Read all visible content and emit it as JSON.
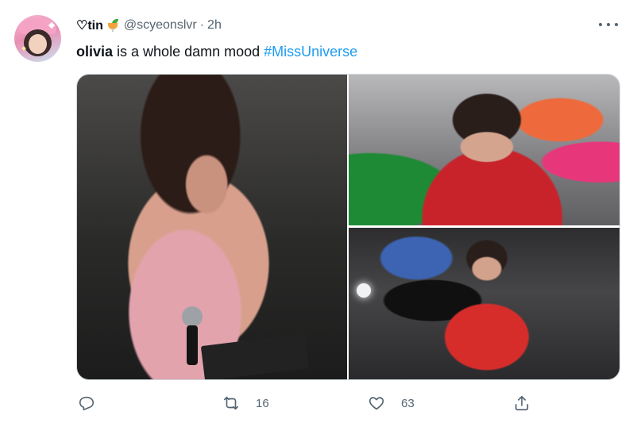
{
  "tweet": {
    "author": {
      "display_name": "♡tin",
      "handle": "@scyeonslvr",
      "separator": "·",
      "time": "2h"
    },
    "text": {
      "bold_word": "olivia",
      "rest": " is a whole damn mood ",
      "hashtag": "#MissUniverse"
    },
    "media": {
      "photos": [
        {
          "description_icon": "photo"
        },
        {
          "description_icon": "photo"
        },
        {
          "description_icon": "photo"
        }
      ]
    },
    "actions": {
      "reply_count": "",
      "retweet_count": "16",
      "like_count": "63"
    }
  },
  "colors": {
    "accent": "#1d9bf0",
    "muted": "#536471",
    "text": "#0f1419",
    "border": "#cfd9de"
  },
  "icons": {
    "more": "more-icon",
    "reply": "reply-icon",
    "retweet": "retweet-icon",
    "like": "heart-icon",
    "share": "share-icon",
    "drink": "tropical-drink-icon"
  }
}
